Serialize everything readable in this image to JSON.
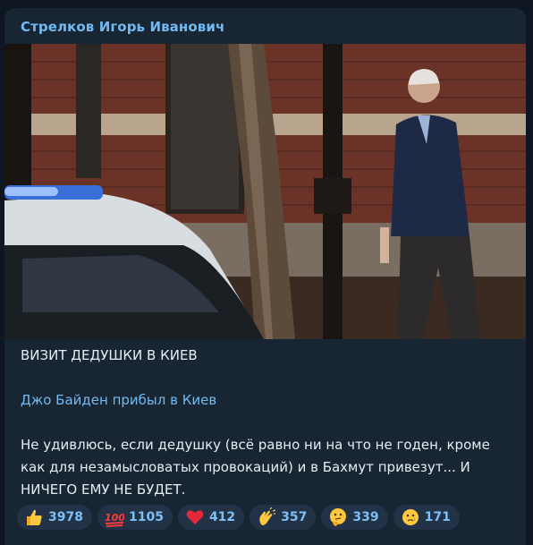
{
  "post": {
    "channel_name": "Стрелков Игорь Иванович",
    "photo_alt": "Джо Байден прибыл в Киев",
    "heading": "ВИЗИТ ДЕДУШКИ В КИЕВ",
    "link_text": "Джо Байден прибыл в Киев",
    "body_text": "Не удивлюсь, если дедушку (всё равно ни на что не годен, кроме как для незамысловатых провокаций) и в Бахмут привезут... И НИЧЕГО ЕМУ НЕ БУДЕТ."
  },
  "reactions": [
    {
      "icon": "thumbs-up-icon",
      "count": "3978"
    },
    {
      "icon": "hundred-points-icon",
      "count": "1105"
    },
    {
      "icon": "red-heart-icon",
      "count": "412"
    },
    {
      "icon": "clapping-hands-icon",
      "count": "357"
    },
    {
      "icon": "thinking-face-icon",
      "count": "339"
    },
    {
      "icon": "crying-face-icon",
      "count": "171"
    }
  ],
  "colors": {
    "background": "#0e1621",
    "bubble": "#182533",
    "accent": "#71baf2",
    "reaction_bg": "#223247"
  }
}
